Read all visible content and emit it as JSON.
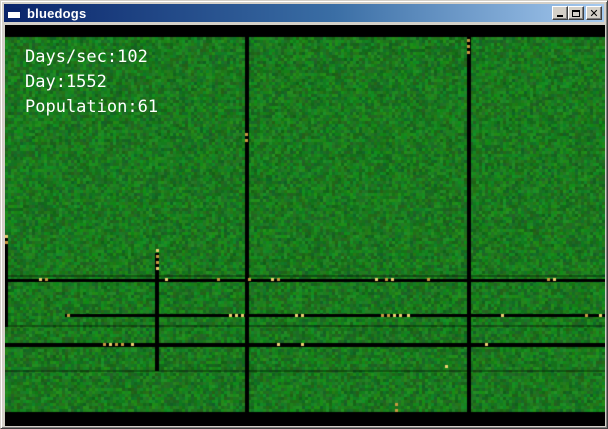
{
  "window": {
    "title": "bluedogs",
    "icon": "window-app-icon",
    "buttons": {
      "minimize_icon": "minimize-icon",
      "maximize_icon": "maximize-icon",
      "close_icon": "close-icon",
      "close_label": "✕"
    }
  },
  "stats": {
    "days_per_sec": "Days/sec:102",
    "day": "Day:1552",
    "population": "Population:61"
  },
  "colors": {
    "grass_dark": "#0f5a14",
    "grass_mid": "#1a7a1e",
    "grass_light": "#2a9030",
    "path": "#000000",
    "dog": "#e8c060"
  }
}
